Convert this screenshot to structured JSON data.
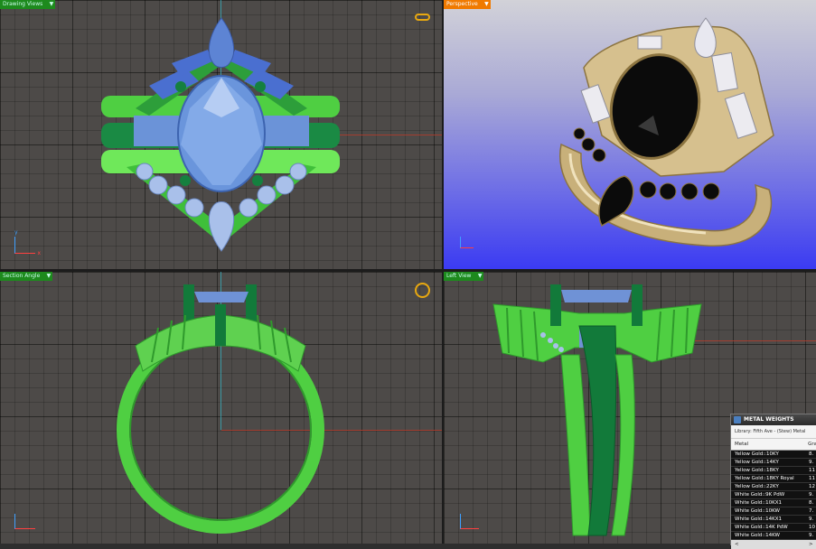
{
  "viewports": {
    "top_left": {
      "label": "Drawing Views",
      "icon": "ring-icon"
    },
    "top_right": {
      "label": "Perspective"
    },
    "bottom_left": {
      "label": "Section Angle",
      "icon": "ring-outline-icon"
    },
    "bottom_right": {
      "label": "Left View"
    }
  },
  "axis_labels": {
    "x": "x",
    "y": "y"
  },
  "metal_weights": {
    "title": "METAL WEIGHTS",
    "library": "Library: Fifth Ave - (Stew) Metal",
    "columns": [
      "Metal",
      "Gra"
    ],
    "rows": [
      {
        "metal": "Yellow Gold::10KY",
        "value": "8."
      },
      {
        "metal": "Yellow Gold::14KY",
        "value": "9."
      },
      {
        "metal": "Yellow Gold::18KY",
        "value": "11"
      },
      {
        "metal": "Yellow Gold::18KY Royal",
        "value": "11"
      },
      {
        "metal": "Yellow Gold::22KY",
        "value": "12"
      },
      {
        "metal": "White Gold::9K PdW",
        "value": "9."
      },
      {
        "metal": "White Gold::10KX1",
        "value": "8."
      },
      {
        "metal": "White Gold::10KW",
        "value": "7."
      },
      {
        "metal": "White Gold::14KX1",
        "value": "9."
      },
      {
        "metal": "White Gold::14K PdW",
        "value": "10"
      },
      {
        "metal": "White Gold::14KW",
        "value": "9."
      }
    ],
    "footer": [
      "<",
      ">"
    ]
  },
  "colors": {
    "band_light": "#6fe85a",
    "band_dark": "#127a3a",
    "gem_blue": "#7fa6e6",
    "gold": "#d6c08e",
    "onyx": "#0b0b0b"
  }
}
